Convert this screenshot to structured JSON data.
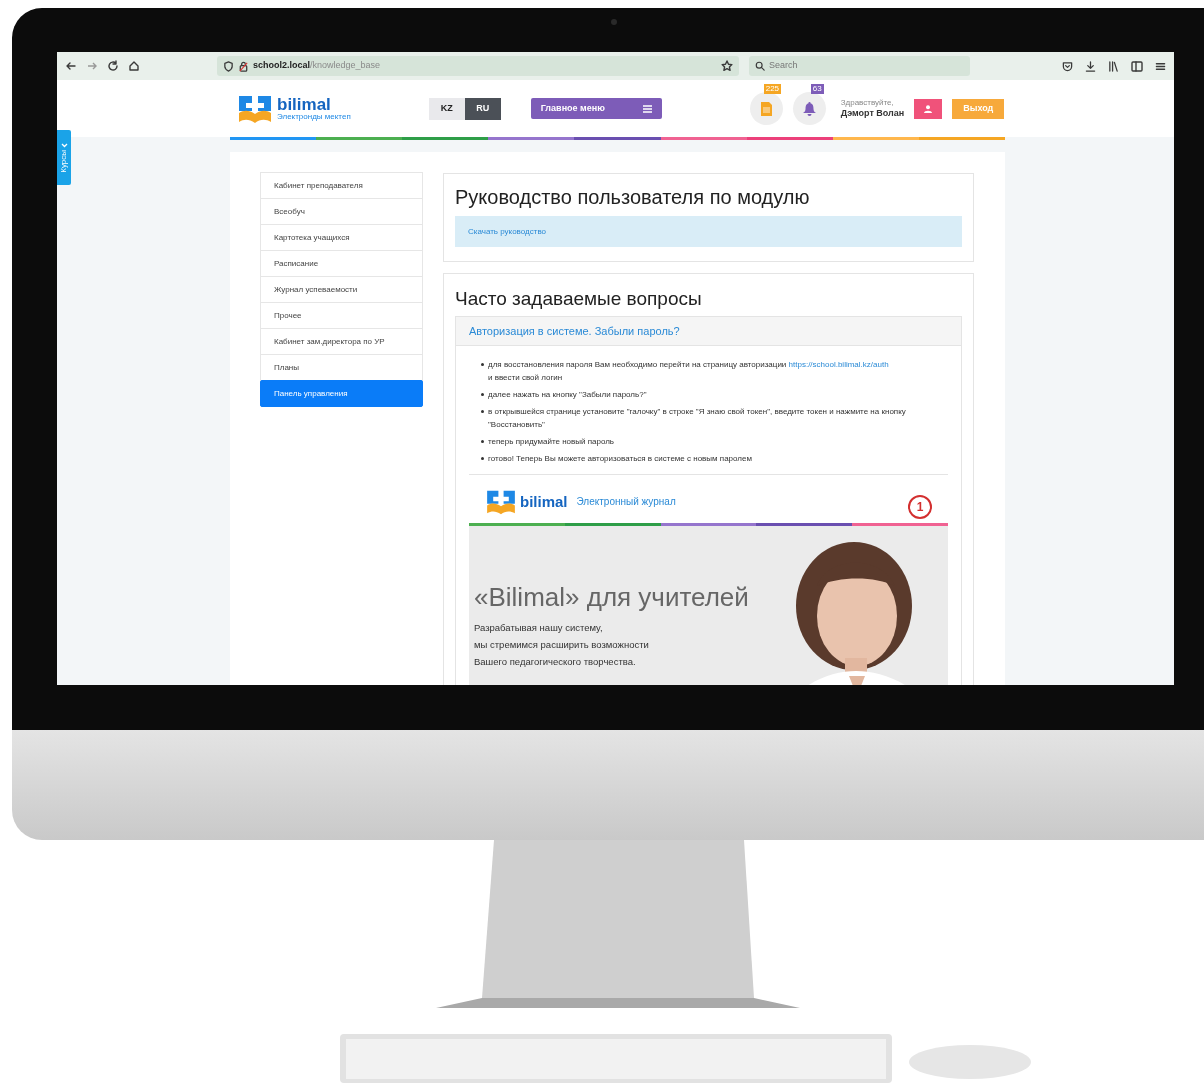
{
  "browser": {
    "url_host": "school2.local",
    "url_path": "/knowledge_base",
    "search_placeholder": "Search"
  },
  "site_header": {
    "logo": {
      "name": "bilimal",
      "tagline": "Электронды мектеп"
    },
    "languages": [
      {
        "label": "KZ",
        "selected": false
      },
      {
        "label": "RU",
        "selected": true
      }
    ],
    "main_menu": "Главное меню",
    "badges": [
      {
        "kind": "document",
        "count": "225"
      },
      {
        "kind": "bell",
        "count": "63"
      }
    ],
    "greeting": "Здравствуйте,",
    "user_name": "Дэморт Волан",
    "logout": "Выход"
  },
  "courses_tab": "Курсы",
  "sidebar": {
    "items": [
      {
        "label": "Кабинет преподавателя",
        "selected": false
      },
      {
        "label": "Всеобуч",
        "selected": false
      },
      {
        "label": "Картотека учащихся",
        "selected": false
      },
      {
        "label": "Расписание",
        "selected": false
      },
      {
        "label": "Журнал успеваемости",
        "selected": false
      },
      {
        "label": "Прочее",
        "selected": false
      },
      {
        "label": "Кабинет зам.директора по УР",
        "selected": false
      },
      {
        "label": "Планы",
        "selected": false
      },
      {
        "label": "Панель управления",
        "selected": true
      }
    ]
  },
  "guide": {
    "title": "Руководство пользователя по модулю",
    "link": "Скачать руководство"
  },
  "faq": {
    "title": "Часто задаваемые вопросы",
    "items": [
      {
        "question": "Авторизация в системе. Забыли пароль?",
        "expanded": true,
        "answer": [
          {
            "text": "для восстановления пароля Вам необходимо перейти на страницу авторизации",
            "link": "https://school.bilimal.kz/auth",
            "tail": "и ввести свой логин"
          },
          {
            "text": "далее нажать на кнопку \"Забыли пароль?\""
          },
          {
            "text": "в открывшейся странице установите \"галочку\" в строке \"Я знаю свой токен\", введите токен и нажмите на кнопку \"Восстановить\""
          },
          {
            "text": "теперь придумайте новый пароль"
          },
          {
            "text": "готово! Теперь Вы можете авторизоваться в системе с новым паролем"
          }
        ],
        "screenshot": {
          "logo_name": "bilimal",
          "subtitle": "Электронный журнал",
          "marker": "1",
          "heading": "«Bilimal» для учителей",
          "lines": [
            "Разрабатывая нашу систему,",
            "мы стремимся расширить возможности",
            "Вашего педагогического творчества."
          ]
        }
      }
    ]
  }
}
